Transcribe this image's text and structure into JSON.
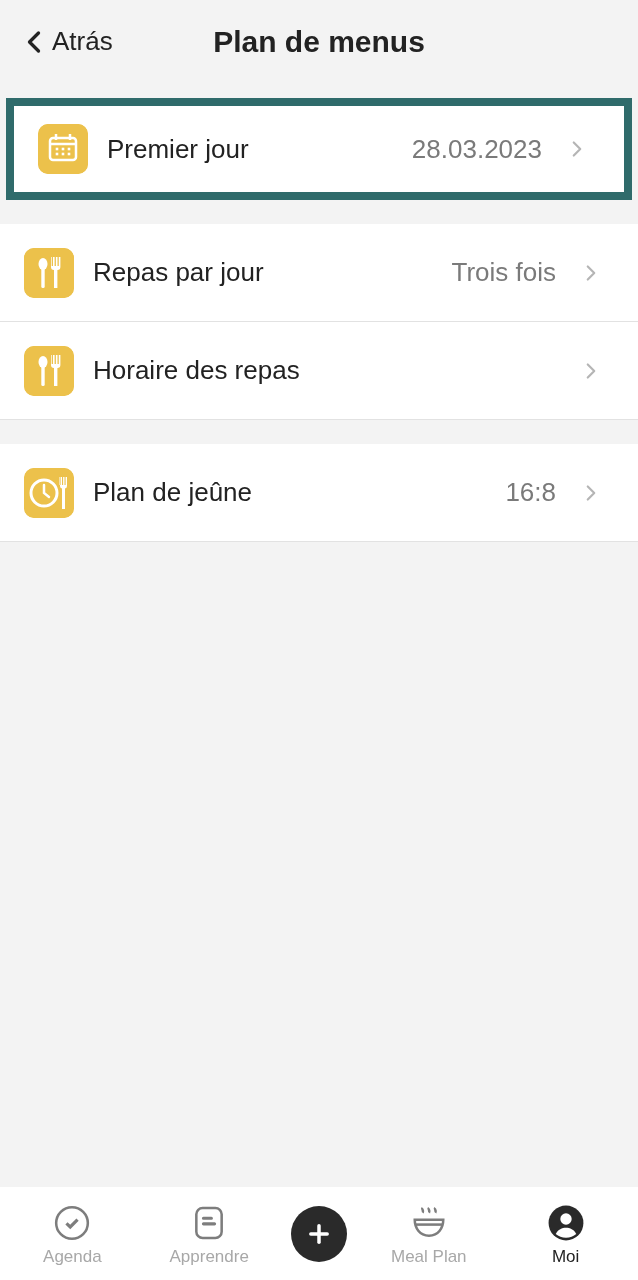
{
  "header": {
    "back": "Atrás",
    "title": "Plan de menus"
  },
  "groups": [
    {
      "rows": [
        {
          "kind": "calendar",
          "label": "Premier jour",
          "value": "28.03.2023",
          "highlighted": true
        }
      ]
    },
    {
      "rows": [
        {
          "kind": "utensils",
          "label": "Repas par jour",
          "value": "Trois fois",
          "highlighted": false
        },
        {
          "kind": "utensils",
          "label": "Horaire des repas",
          "highlighted": false
        }
      ]
    },
    {
      "rows": [
        {
          "kind": "fasting",
          "label": "Plan de jeûne",
          "value": "16:8",
          "highlighted": false
        }
      ]
    }
  ],
  "tab_bar": [
    {
      "kind": "check",
      "label": "Agenda",
      "selected": false
    },
    {
      "kind": "learn",
      "label": "Apprendre",
      "selected": false
    },
    {
      "kind": "add"
    },
    {
      "kind": "bowl",
      "label": "Meal Plan",
      "selected": false
    },
    {
      "kind": "profile",
      "label": "Moi",
      "selected": true
    }
  ]
}
